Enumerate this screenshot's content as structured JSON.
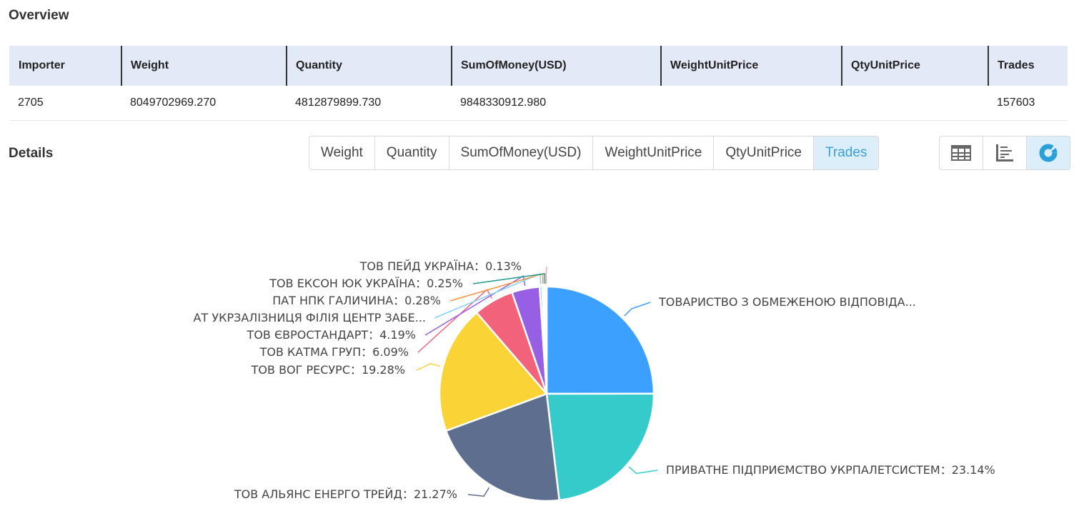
{
  "overview": {
    "title": "Overview",
    "headers": [
      "Importer",
      "Weight",
      "Quantity",
      "SumOfMoney(USD)",
      "WeightUnitPrice",
      "QtyUnitPrice",
      "Trades"
    ],
    "row": [
      "2705",
      "8049702969.270",
      "4812879899.730",
      "9848330912.980",
      "",
      "",
      "157603"
    ]
  },
  "details": {
    "title": "Details",
    "tabs": [
      "Weight",
      "Quantity",
      "SumOfMoney(USD)",
      "WeightUnitPrice",
      "QtyUnitPrice",
      "Trades"
    ],
    "active_tab": "Trades",
    "views": [
      {
        "icon": "table-icon"
      },
      {
        "icon": "bar-chart-icon"
      },
      {
        "icon": "pie-chart-icon",
        "active": true
      }
    ]
  },
  "chart_data": {
    "type": "pie",
    "legend": "none",
    "slices": [
      {
        "name": "ТОВАРИСТВО З ОБМЕЖЕНОЮ ВІДПОВІДА...",
        "value": 24.98,
        "label": "ТОВАРИСТВО З ОБМЕЖЕНОЮ ВІДПОВІДА...",
        "color": "#3ba0ff"
      },
      {
        "name": "ПРИВАТНЕ ПІДПРИЄМСТВО УКРПАЛЕТСИСТЕМ",
        "value": 23.14,
        "label": "ПРИВАТНЕ ПІДПРИЄМСТВО УКРПАЛЕТСИСТЕМ：23.14%",
        "color": "#36cbcb"
      },
      {
        "name": "ТОВ АЛЬЯНС ЕНЕРГО ТРЕЙД",
        "value": 21.27,
        "label": "ТОВ АЛЬЯНС ЕНЕРГО ТРЕЙД：21.27%",
        "color": "#5d6e8e"
      },
      {
        "name": "ТОВ ВОГ РЕСУРС",
        "value": 19.28,
        "label": "ТОВ ВОГ РЕСУРС：19.28%",
        "color": "#fad337"
      },
      {
        "name": "ТОВ КАТМА ГРУП",
        "value": 6.09,
        "label": "ТОВ КАТМА ГРУП：6.09%",
        "color": "#f2637b"
      },
      {
        "name": "ТОВ ЄВРОСТАНДАРТ",
        "value": 4.19,
        "label": "ТОВ ЄВРОСТАНДАРТ：4.19%",
        "color": "#975fe4"
      },
      {
        "name": "АТ УКРЗАЛІЗНИЦЯ ФІЛІЯ ЦЕНТР ЗАБЕ...",
        "value": 0.39,
        "label": "АТ УКРЗАЛІЗНИЦЯ ФІЛІЯ ЦЕНТР ЗАБЕ...",
        "color": "#7ed3f4"
      },
      {
        "name": "ПАТ НПК ГАЛИЧИНА",
        "value": 0.28,
        "label": "ПАТ НПК ГАЛИЧИНА：0.28%",
        "color": "#f6903d"
      },
      {
        "name": "ТОВ ЕКСОН ЮК УКРАЇНА",
        "value": 0.25,
        "label": "ТОВ ЕКСОН ЮК УКРАЇНА：0.25%",
        "color": "#1f9a8e"
      },
      {
        "name": "ТОВ ПЕЙД УКРАЇНА",
        "value": 0.13,
        "label": "ТОВ ПЕЙД УКРАЇНА：0.13%",
        "color": "#f7a1c4"
      }
    ]
  }
}
